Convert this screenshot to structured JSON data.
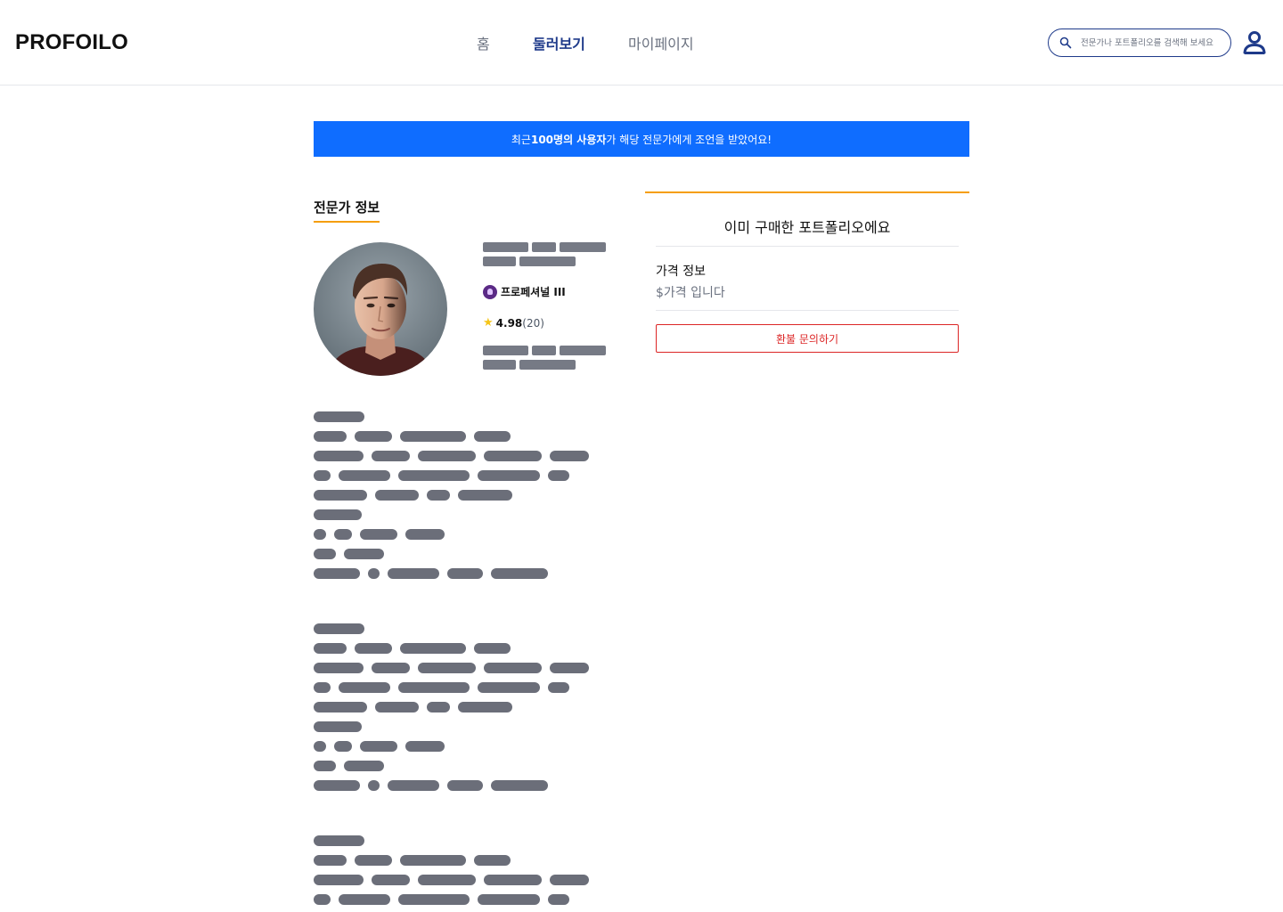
{
  "header": {
    "logo": "PROFOILO",
    "nav": [
      "홈",
      "둘러보기",
      "마이페이지"
    ],
    "active_nav": "둘러보기",
    "search_placeholder": "전문가나 포트폴리오를 검색해 보세요",
    "icons": {
      "search": "search-icon",
      "profile": "user-icon"
    }
  },
  "banner": {
    "prefix": "최근 ",
    "highlight": "100명의 사용자",
    "suffix": "가 해당 전문가에게 조언을 받았어요!"
  },
  "expert": {
    "section_title": "전문가 정보",
    "grade": "프로페셔널 III",
    "rating": "4.98",
    "review_count": "(20)",
    "avatar_alt": "expert profile photo"
  },
  "purchase_card": {
    "title": "이미 구매한 포트폴리오에요",
    "price_label": "가격 정보",
    "price_value": "$가격 입니다",
    "refund_button": "환불 문의하기"
  },
  "colors": {
    "brand_blue": "#0f6dff",
    "nav_active": "#1e3a8a",
    "accent_orange": "#f59e0b",
    "danger": "#dc2626",
    "skeleton": "#6b6e79"
  }
}
